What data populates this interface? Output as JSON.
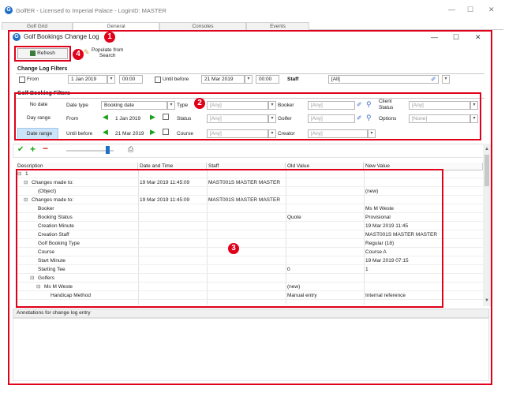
{
  "window": {
    "title": "GolfER - Licensed to Imperial Palace - LoginID: MASTER",
    "minimize": "—",
    "maximize": "☐",
    "close": "✕",
    "tabs": [
      "Golf Grid",
      "General",
      "Consoles",
      "Events"
    ]
  },
  "dialog": {
    "title": "Golf Bookings Change Log",
    "minimize": "—",
    "maximize": "☐",
    "close": "✕",
    "refresh_label": "Refresh",
    "populate_label_1": "Populate from",
    "populate_label_2": "Search"
  },
  "annotations_markers": [
    "1",
    "2",
    "3",
    "4"
  ],
  "change_log_filters": {
    "section_title": "Change Log Filters",
    "from_label": "From",
    "from_date": "1 Jan 2019",
    "from_time": "00:00",
    "until_label": "Until before",
    "until_date": "21 Mar 2019",
    "until_time": "00:00",
    "staff_label": "Staff",
    "staff_value": "[All]"
  },
  "golf_booking_filters": {
    "section_title": "Golf Booking Filters",
    "rows": [
      {
        "mode": "No date",
        "date_label": "Date type",
        "date_value": "Booking date",
        "f1_label": "Type",
        "f1_value": "[Any]",
        "f2_label": "Booker",
        "f2_value": "[Any]",
        "f3_label": "Client Status",
        "f3_value": "[Any]"
      },
      {
        "mode": "Day range",
        "date_label": "From",
        "date_value": "1 Jan 2019",
        "f1_label": "Status",
        "f1_value": "[Any]",
        "f2_label": "Golfer",
        "f2_value": "[Any]",
        "f3_label": "Options",
        "f3_value": "[None]"
      },
      {
        "mode": "Date range",
        "date_label": "Until before",
        "date_value": "21 Mar 2019",
        "f1_label": "Course",
        "f1_value": "[Any]",
        "f2_label": "Creator",
        "f2_value": "[Any]"
      }
    ]
  },
  "grid": {
    "columns": [
      "Description",
      "Date and Time",
      "Staff",
      "Old Value",
      "New Value"
    ],
    "rows": [
      {
        "desc": "1",
        "dt": "",
        "staff": "",
        "old": "",
        "new": ""
      },
      {
        "desc": "Changes made to:",
        "dt": "19 Mar 2019 11:45:09",
        "staff": "MAST001S MASTER MASTER",
        "old": "",
        "new": ""
      },
      {
        "desc": "(Object)",
        "dt": "",
        "staff": "",
        "old": "",
        "new": "(new)"
      },
      {
        "desc": "Changes made to:",
        "dt": "19 Mar 2019 11:45:09",
        "staff": "MAST001S MASTER MASTER",
        "old": "",
        "new": ""
      },
      {
        "desc": "Booker",
        "dt": "",
        "staff": "",
        "old": "",
        "new": "Ms M Weste"
      },
      {
        "desc": "Booking Status",
        "dt": "",
        "staff": "",
        "old": "Quote",
        "new": "Provisional"
      },
      {
        "desc": "Creation Minute",
        "dt": "",
        "staff": "",
        "old": "",
        "new": "19 Mar 2019 11:45"
      },
      {
        "desc": "Creation Staff",
        "dt": "",
        "staff": "",
        "old": "",
        "new": "MAST001S MASTER MASTER"
      },
      {
        "desc": "Golf Booking Type",
        "dt": "",
        "staff": "",
        "old": "",
        "new": "Regular (18)"
      },
      {
        "desc": "Course",
        "dt": "",
        "staff": "",
        "old": "",
        "new": "Course A"
      },
      {
        "desc": "Start Minute",
        "dt": "",
        "staff": "",
        "old": "",
        "new": "19 Mar 2019 07:15"
      },
      {
        "desc": "Starting Tee",
        "dt": "",
        "staff": "",
        "old": "0",
        "new": "1"
      },
      {
        "desc": "Golfers",
        "dt": "",
        "staff": "",
        "old": "",
        "new": ""
      },
      {
        "desc": "Ms M Weste",
        "dt": "",
        "staff": "",
        "old": "(new)",
        "new": ""
      },
      {
        "desc": "Handicap Method",
        "dt": "",
        "staff": "",
        "old": "Manual entry",
        "new": "Internal reference"
      }
    ]
  },
  "annotations_panel": {
    "title": "Annotations for change log entry"
  },
  "colors": {
    "highlight": "#e0001a",
    "accent": "#1f6fc8",
    "arrow": "#1aa31a"
  }
}
